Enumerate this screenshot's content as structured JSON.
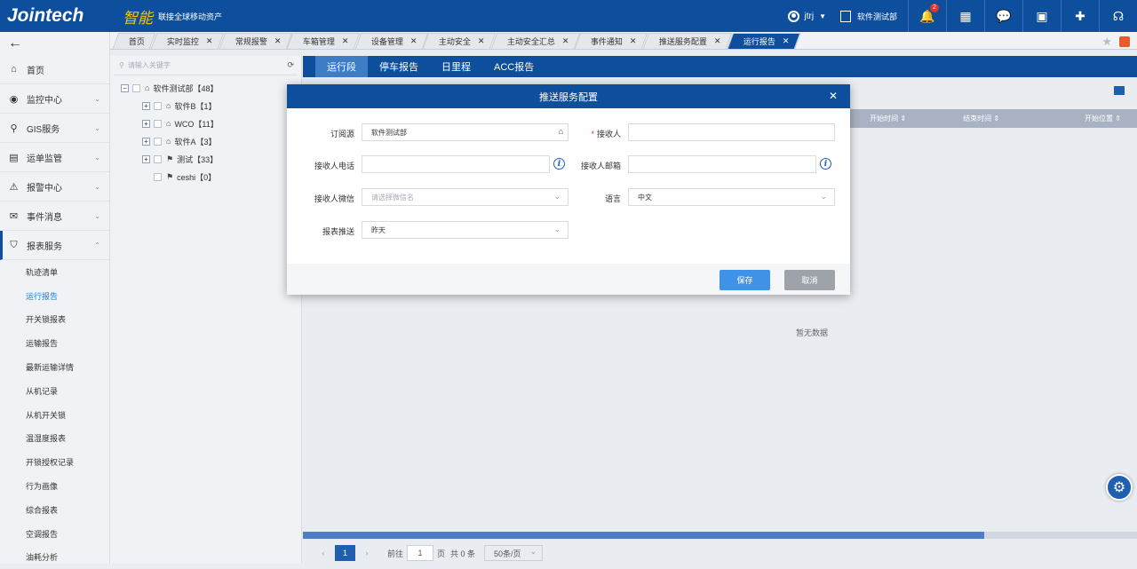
{
  "header": {
    "logo": "Jointech",
    "brand_zh": "智能",
    "slogan": "联接全球移动资产",
    "user": "jtrj",
    "org": "软件测试部",
    "notify_count": "2"
  },
  "tabs": [
    {
      "label": "首页",
      "closable": false
    },
    {
      "label": "实时监控",
      "closable": true
    },
    {
      "label": "常规报警",
      "closable": true
    },
    {
      "label": "车箱管理",
      "closable": true
    },
    {
      "label": "设备管理",
      "closable": true
    },
    {
      "label": "主动安全",
      "closable": true
    },
    {
      "label": "主动安全汇总",
      "closable": true
    },
    {
      "label": "事件通知",
      "closable": true
    },
    {
      "label": "推送服务配置",
      "closable": true
    },
    {
      "label": "运行报告",
      "closable": true,
      "active": true
    }
  ],
  "sidebar": {
    "items": [
      {
        "label": "首页",
        "icon": "home-icon"
      },
      {
        "label": "监控中心",
        "icon": "monitor-icon"
      },
      {
        "label": "GIS服务",
        "icon": "gis-icon"
      },
      {
        "label": "运单监管",
        "icon": "waybill-icon"
      },
      {
        "label": "报警中心",
        "icon": "alarm-icon"
      },
      {
        "label": "事件消息",
        "icon": "mail-icon"
      },
      {
        "label": "报表服务",
        "icon": "shield-icon"
      }
    ],
    "subitems": [
      "轨迹清单",
      "运行报告",
      "开关锁报表",
      "运输报告",
      "最新运输详情",
      "从机记录",
      "从机开关锁",
      "温湿度报表",
      "开锁授权记录",
      "行为画像",
      "综合报表",
      "空调报告",
      "油耗分析"
    ]
  },
  "tree": {
    "search_placeholder": "请输入关键字",
    "root": "软件测试部【48】",
    "nodes": [
      "软件B【1】",
      "WCO【11】",
      "软件A【3】",
      "测试【33】",
      "ceshi【0】"
    ]
  },
  "subtabs": [
    "运行段",
    "停车报告",
    "日里程",
    "ACC报告"
  ],
  "table": {
    "headers": [
      "开始时间",
      "结束时间",
      "开始位置"
    ],
    "empty": "暂无数据"
  },
  "pager": {
    "current": "1",
    "goto_label": "前往",
    "page_value": "1",
    "page_unit": "页",
    "total": "共 0 条",
    "page_size": "50条/页"
  },
  "modal": {
    "title": "推送服务配置",
    "fields": {
      "source_label": "订阅源",
      "source_value": "软件测试部",
      "receiver_label": "接收人",
      "receiver_value": "",
      "phone_label": "接收人电话",
      "phone_value": "",
      "email_label": "接收人邮箱",
      "email_value": "",
      "wechat_label": "接收人微信",
      "wechat_placeholder": "请选择微信名",
      "lang_label": "语言",
      "lang_value": "中文",
      "push_label": "报表推送",
      "push_value": "昨天"
    },
    "save": "保存",
    "cancel": "取消"
  },
  "colors": {
    "primary": "#0d4f9c",
    "accent": "#3e93e8",
    "required": "#e0352b"
  }
}
